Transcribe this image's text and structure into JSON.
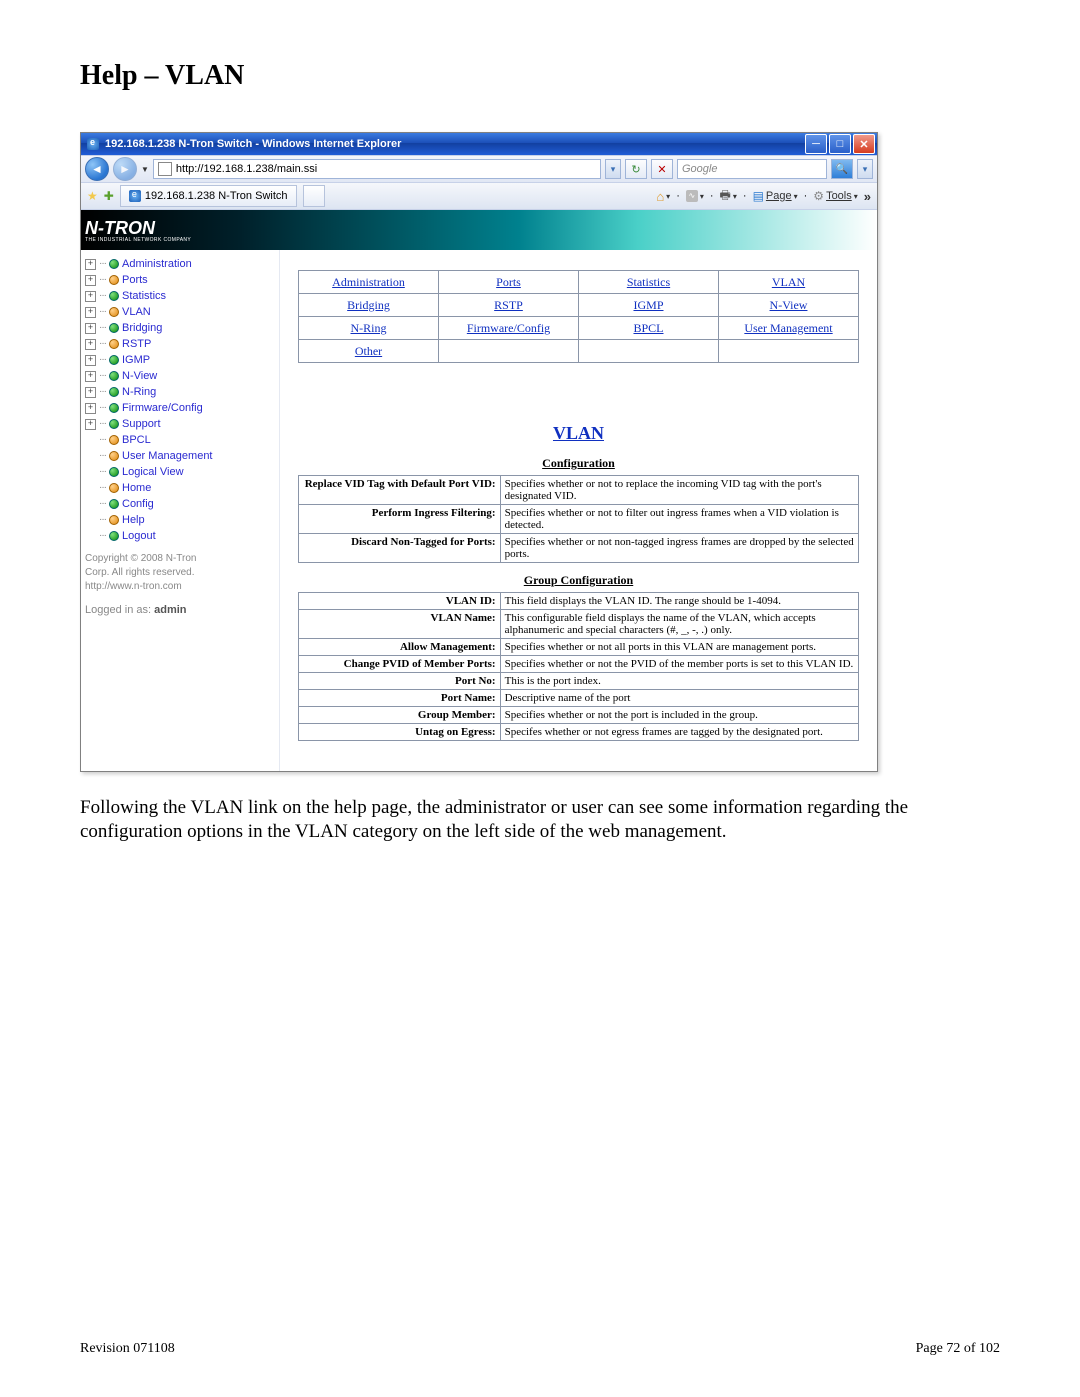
{
  "page_title": "Help – VLAN",
  "ie": {
    "title": "192.168.1.238 N-Tron Switch - Windows Internet Explorer",
    "e_icon": "e",
    "url": "http://192.168.1.238/main.ssi",
    "search_placeholder": "Google",
    "tab_label": "192.168.1.238 N-Tron Switch",
    "cmd_page": "Page",
    "cmd_tools": "Tools",
    "chevrons": "»"
  },
  "logo": {
    "text": "N-TRON",
    "sub": "THE INDUSTRIAL NETWORK COMPANY"
  },
  "sidebar": {
    "items": [
      {
        "label": "Administration",
        "bullet": "green",
        "expand": true
      },
      {
        "label": "Ports",
        "bullet": "orange",
        "expand": true
      },
      {
        "label": "Statistics",
        "bullet": "green",
        "expand": true
      },
      {
        "label": "VLAN",
        "bullet": "orange",
        "expand": true
      },
      {
        "label": "Bridging",
        "bullet": "green",
        "expand": true
      },
      {
        "label": "RSTP",
        "bullet": "orange",
        "expand": true
      },
      {
        "label": "IGMP",
        "bullet": "green",
        "expand": true
      },
      {
        "label": "N-View",
        "bullet": "green",
        "expand": true
      },
      {
        "label": "N-Ring",
        "bullet": "green",
        "expand": true
      },
      {
        "label": "Firmware/Config",
        "bullet": "green",
        "expand": true
      },
      {
        "label": "Support",
        "bullet": "green",
        "expand": true
      },
      {
        "label": "BPCL",
        "bullet": "orange",
        "expand": false
      },
      {
        "label": "User Management",
        "bullet": "orange",
        "expand": false
      },
      {
        "label": "Logical View",
        "bullet": "green",
        "expand": false
      },
      {
        "label": "Home",
        "bullet": "orange",
        "expand": false
      },
      {
        "label": "Config",
        "bullet": "green",
        "expand": false
      },
      {
        "label": "Help",
        "bullet": "orange",
        "expand": false
      },
      {
        "label": "Logout",
        "bullet": "green",
        "expand": false
      }
    ],
    "copyright1": "Copyright © 2008 N-Tron",
    "copyright2": "Corp. All rights reserved.",
    "copyright3": "http://www.n-tron.com",
    "logged_prefix": "Logged in as: ",
    "logged_user": "admin"
  },
  "nav_grid": [
    [
      "Administration",
      "Ports",
      "Statistics",
      "VLAN"
    ],
    [
      "Bridging",
      "RSTP",
      "IGMP",
      "N-View"
    ],
    [
      "N-Ring",
      "Firmware/Config",
      "BPCL",
      "User Management"
    ],
    [
      "Other",
      "",
      "",
      ""
    ]
  ],
  "section_title": "VLAN",
  "config_heading": "Configuration",
  "config_rows": [
    {
      "k": "Replace VID Tag with Default Port VID:",
      "v": "Specifies whether or not to replace the incoming VID tag with the port's designated VID."
    },
    {
      "k": "Perform Ingress Filtering:",
      "v": "Specifies whether or not to filter out ingress frames when a VID violation is detected."
    },
    {
      "k": "Discard Non-Tagged for Ports:",
      "v": "Specifies whether or not non-tagged ingress frames are dropped by the selected ports."
    }
  ],
  "group_heading": "Group Configuration",
  "group_rows": [
    {
      "k": "VLAN ID:",
      "v": "This field displays the VLAN ID. The range should be 1-4094."
    },
    {
      "k": "VLAN Name:",
      "v": "This configurable field displays the name of the VLAN, which accepts alphanumeric and special characters (#, _, -, .) only."
    },
    {
      "k": "Allow Management:",
      "v": "Specifies whether or not all ports in this VLAN are management ports."
    },
    {
      "k": "Change PVID of Member Ports:",
      "v": "Specifies whether or not the PVID of the member ports is set to this VLAN ID."
    },
    {
      "k": "Port No:",
      "v": "This is the port index."
    },
    {
      "k": "Port Name:",
      "v": "Descriptive name of the port"
    },
    {
      "k": "Group Member:",
      "v": "Specifies whether or not the port is included in the group."
    },
    {
      "k": "Untag on Egress:",
      "v": "Specifes whether or not egress frames are tagged by the designated port."
    }
  ],
  "body_text": "Following the VLAN link on the help page, the administrator or user can see some information regarding the configuration options in the VLAN category on the left side of the web management.",
  "footer_left": "Revision 071108",
  "footer_right": "Page 72 of 102"
}
